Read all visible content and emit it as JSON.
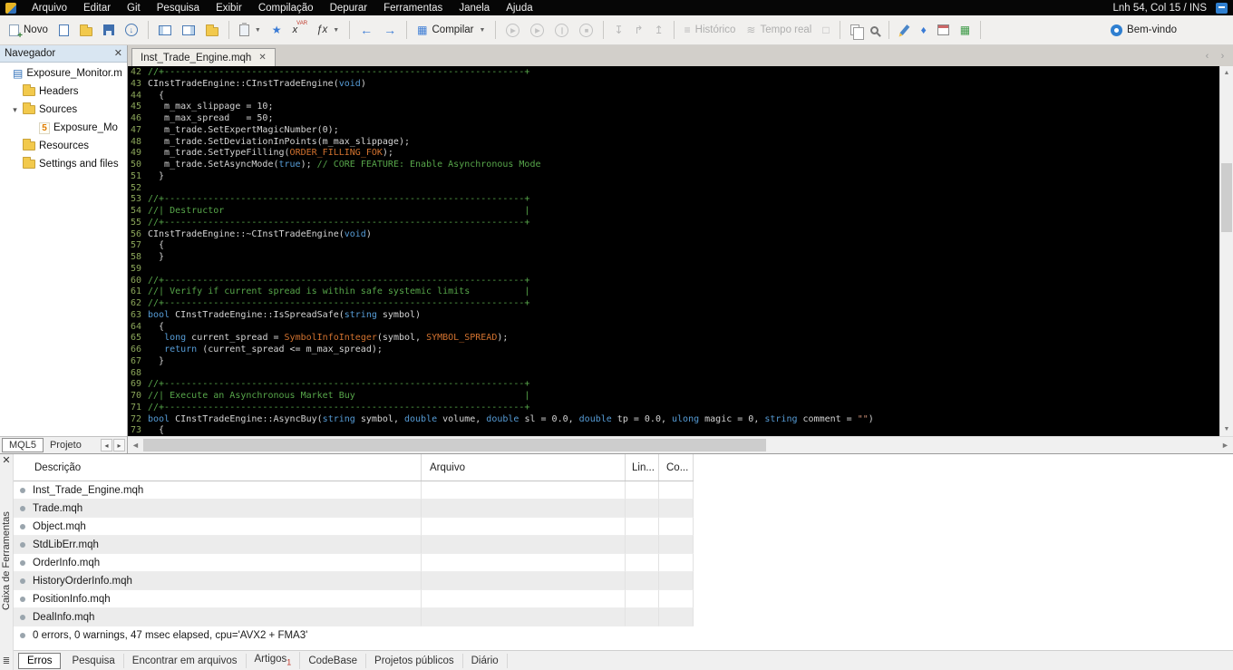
{
  "colors": {
    "comment_green": "#57a64a",
    "keyword_blue": "#569cd6",
    "constant_orange": "#d2722f",
    "string_orange": "#ce9178",
    "editor_bg": "#000000",
    "line_number_green": "#8ba65a",
    "accent_blue": "#2f6fb8"
  },
  "menubar": {
    "items": [
      "Arquivo",
      "Editar",
      "Git",
      "Pesquisa",
      "Exibir",
      "Compilação",
      "Depurar",
      "Ferramentas",
      "Janela",
      "Ajuda"
    ],
    "caret_status": "Lnh 54, Col 15 / INS"
  },
  "toolbar": {
    "new_label": "Novo",
    "compile_label": "Compilar",
    "history_label": "Histórico",
    "realtime_label": "Tempo real",
    "welcome_label": "Bem-vindo"
  },
  "navigator": {
    "title": "Navegador",
    "tree": [
      {
        "label": "Exposure_Monitor.m",
        "icon": "project",
        "indent": 0,
        "expander": ""
      },
      {
        "label": "Headers",
        "icon": "folder",
        "indent": 1,
        "expander": ""
      },
      {
        "label": "Sources",
        "icon": "folder",
        "indent": 1,
        "expander": "v"
      },
      {
        "label": "Exposure_Mo",
        "icon": "mq5",
        "indent": 2,
        "expander": ""
      },
      {
        "label": "Resources",
        "icon": "folder",
        "indent": 1,
        "expander": ""
      },
      {
        "label": "Settings and files",
        "icon": "folder",
        "indent": 1,
        "expander": ""
      }
    ],
    "tabs": [
      {
        "label": "MQL5",
        "selected": true
      },
      {
        "label": "Projeto",
        "selected": false
      }
    ]
  },
  "editor": {
    "tab_title": "Inst_Trade_Engine.mqh",
    "lines": [
      {
        "n": 42,
        "s": [
          [
            "c",
            "//+------------------------------------------------------------------+"
          ]
        ]
      },
      {
        "n": 43,
        "s": [
          [
            "d",
            "CInstTradeEngine::CInstTradeEngine("
          ],
          [
            "k",
            "void"
          ],
          [
            "d",
            ")"
          ]
        ]
      },
      {
        "n": 44,
        "s": [
          [
            "d",
            "  {"
          ]
        ]
      },
      {
        "n": 45,
        "s": [
          [
            "d",
            "   m_max_slippage = 10;"
          ]
        ]
      },
      {
        "n": 46,
        "s": [
          [
            "d",
            "   m_max_spread   = 50;"
          ]
        ]
      },
      {
        "n": 47,
        "s": [
          [
            "d",
            "   m_trade.SetExpertMagicNumber(0);"
          ]
        ]
      },
      {
        "n": 48,
        "s": [
          [
            "d",
            "   m_trade.SetDeviationInPoints(m_max_slippage);"
          ]
        ]
      },
      {
        "n": 49,
        "s": [
          [
            "d",
            "   m_trade.SetTypeFilling("
          ],
          [
            "e",
            "ORDER_FILLING_FOK"
          ],
          [
            "d",
            ");"
          ]
        ]
      },
      {
        "n": 50,
        "s": [
          [
            "d",
            "   m_trade.SetAsyncMode("
          ],
          [
            "k",
            "true"
          ],
          [
            "d",
            "); "
          ],
          [
            "c",
            "// CORE FEATURE: Enable Asynchronous Mode"
          ]
        ]
      },
      {
        "n": 51,
        "s": [
          [
            "d",
            "  }"
          ]
        ]
      },
      {
        "n": 52,
        "s": []
      },
      {
        "n": 53,
        "s": [
          [
            "c",
            "//+------------------------------------------------------------------+"
          ]
        ]
      },
      {
        "n": 54,
        "s": [
          [
            "c",
            "//| Destructor                                                       |"
          ]
        ]
      },
      {
        "n": 55,
        "s": [
          [
            "c",
            "//+------------------------------------------------------------------+"
          ]
        ]
      },
      {
        "n": 56,
        "s": [
          [
            "d",
            "CInstTradeEngine::~CInstTradeEngine("
          ],
          [
            "k",
            "void"
          ],
          [
            "d",
            ")"
          ]
        ]
      },
      {
        "n": 57,
        "s": [
          [
            "d",
            "  {"
          ]
        ]
      },
      {
        "n": 58,
        "s": [
          [
            "d",
            "  }"
          ]
        ]
      },
      {
        "n": 59,
        "s": []
      },
      {
        "n": 60,
        "s": [
          [
            "c",
            "//+------------------------------------------------------------------+"
          ]
        ]
      },
      {
        "n": 61,
        "s": [
          [
            "c",
            "//| Verify if current spread is within safe systemic limits          |"
          ]
        ]
      },
      {
        "n": 62,
        "s": [
          [
            "c",
            "//+------------------------------------------------------------------+"
          ]
        ]
      },
      {
        "n": 63,
        "s": [
          [
            "k",
            "bool"
          ],
          [
            "d",
            " CInstTradeEngine::IsSpreadSafe("
          ],
          [
            "k",
            "string"
          ],
          [
            "d",
            " symbol)"
          ]
        ]
      },
      {
        "n": 64,
        "s": [
          [
            "d",
            "  {"
          ]
        ]
      },
      {
        "n": 65,
        "s": [
          [
            "d",
            "   "
          ],
          [
            "k",
            "long"
          ],
          [
            "d",
            " current_spread = "
          ],
          [
            "e",
            "SymbolInfoInteger"
          ],
          [
            "d",
            "(symbol, "
          ],
          [
            "e",
            "SYMBOL_SPREAD"
          ],
          [
            "d",
            ");"
          ]
        ]
      },
      {
        "n": 66,
        "s": [
          [
            "d",
            "   "
          ],
          [
            "k",
            "return"
          ],
          [
            "d",
            " (current_spread <= m_max_spread);"
          ]
        ]
      },
      {
        "n": 67,
        "s": [
          [
            "d",
            "  }"
          ]
        ]
      },
      {
        "n": 68,
        "s": []
      },
      {
        "n": 69,
        "s": [
          [
            "c",
            "//+------------------------------------------------------------------+"
          ]
        ]
      },
      {
        "n": 70,
        "s": [
          [
            "c",
            "//| Execute an Asynchronous Market Buy                               |"
          ]
        ]
      },
      {
        "n": 71,
        "s": [
          [
            "c",
            "//+------------------------------------------------------------------+"
          ]
        ]
      },
      {
        "n": 72,
        "s": [
          [
            "k",
            "bool"
          ],
          [
            "d",
            " CInstTradeEngine::AsyncBuy("
          ],
          [
            "k",
            "string"
          ],
          [
            "d",
            " symbol, "
          ],
          [
            "k",
            "double"
          ],
          [
            "d",
            " volume, "
          ],
          [
            "k",
            "double"
          ],
          [
            "d",
            " sl = 0.0, "
          ],
          [
            "k",
            "double"
          ],
          [
            "d",
            " tp = 0.0, "
          ],
          [
            "k",
            "ulong"
          ],
          [
            "d",
            " magic = 0, "
          ],
          [
            "k",
            "string"
          ],
          [
            "d",
            " comment = "
          ],
          [
            "s",
            "\"\""
          ],
          [
            "d",
            ")"
          ]
        ]
      },
      {
        "n": 73,
        "s": [
          [
            "d",
            "  {"
          ]
        ]
      }
    ]
  },
  "toolbox": {
    "vertical_label": "Caixa de Ferramentas",
    "columns": [
      "Descrição",
      "Arquivo",
      "Lin...",
      "Co..."
    ],
    "rows": [
      "Inst_Trade_Engine.mqh",
      "Trade.mqh",
      "Object.mqh",
      "StdLibErr.mqh",
      "OrderInfo.mqh",
      "HistoryOrderInfo.mqh",
      "PositionInfo.mqh",
      "DealInfo.mqh"
    ],
    "status": "0 errors, 0 warnings, 47 msec elapsed, cpu='AVX2 + FMA3'",
    "tabs": [
      {
        "label": "Erros",
        "selected": true
      },
      {
        "label": "Pesquisa"
      },
      {
        "label": "Encontrar em arquivos"
      },
      {
        "label": "Artigos",
        "badge": "1"
      },
      {
        "label": "CodeBase"
      },
      {
        "label": "Projetos públicos"
      },
      {
        "label": "Diário"
      }
    ]
  }
}
